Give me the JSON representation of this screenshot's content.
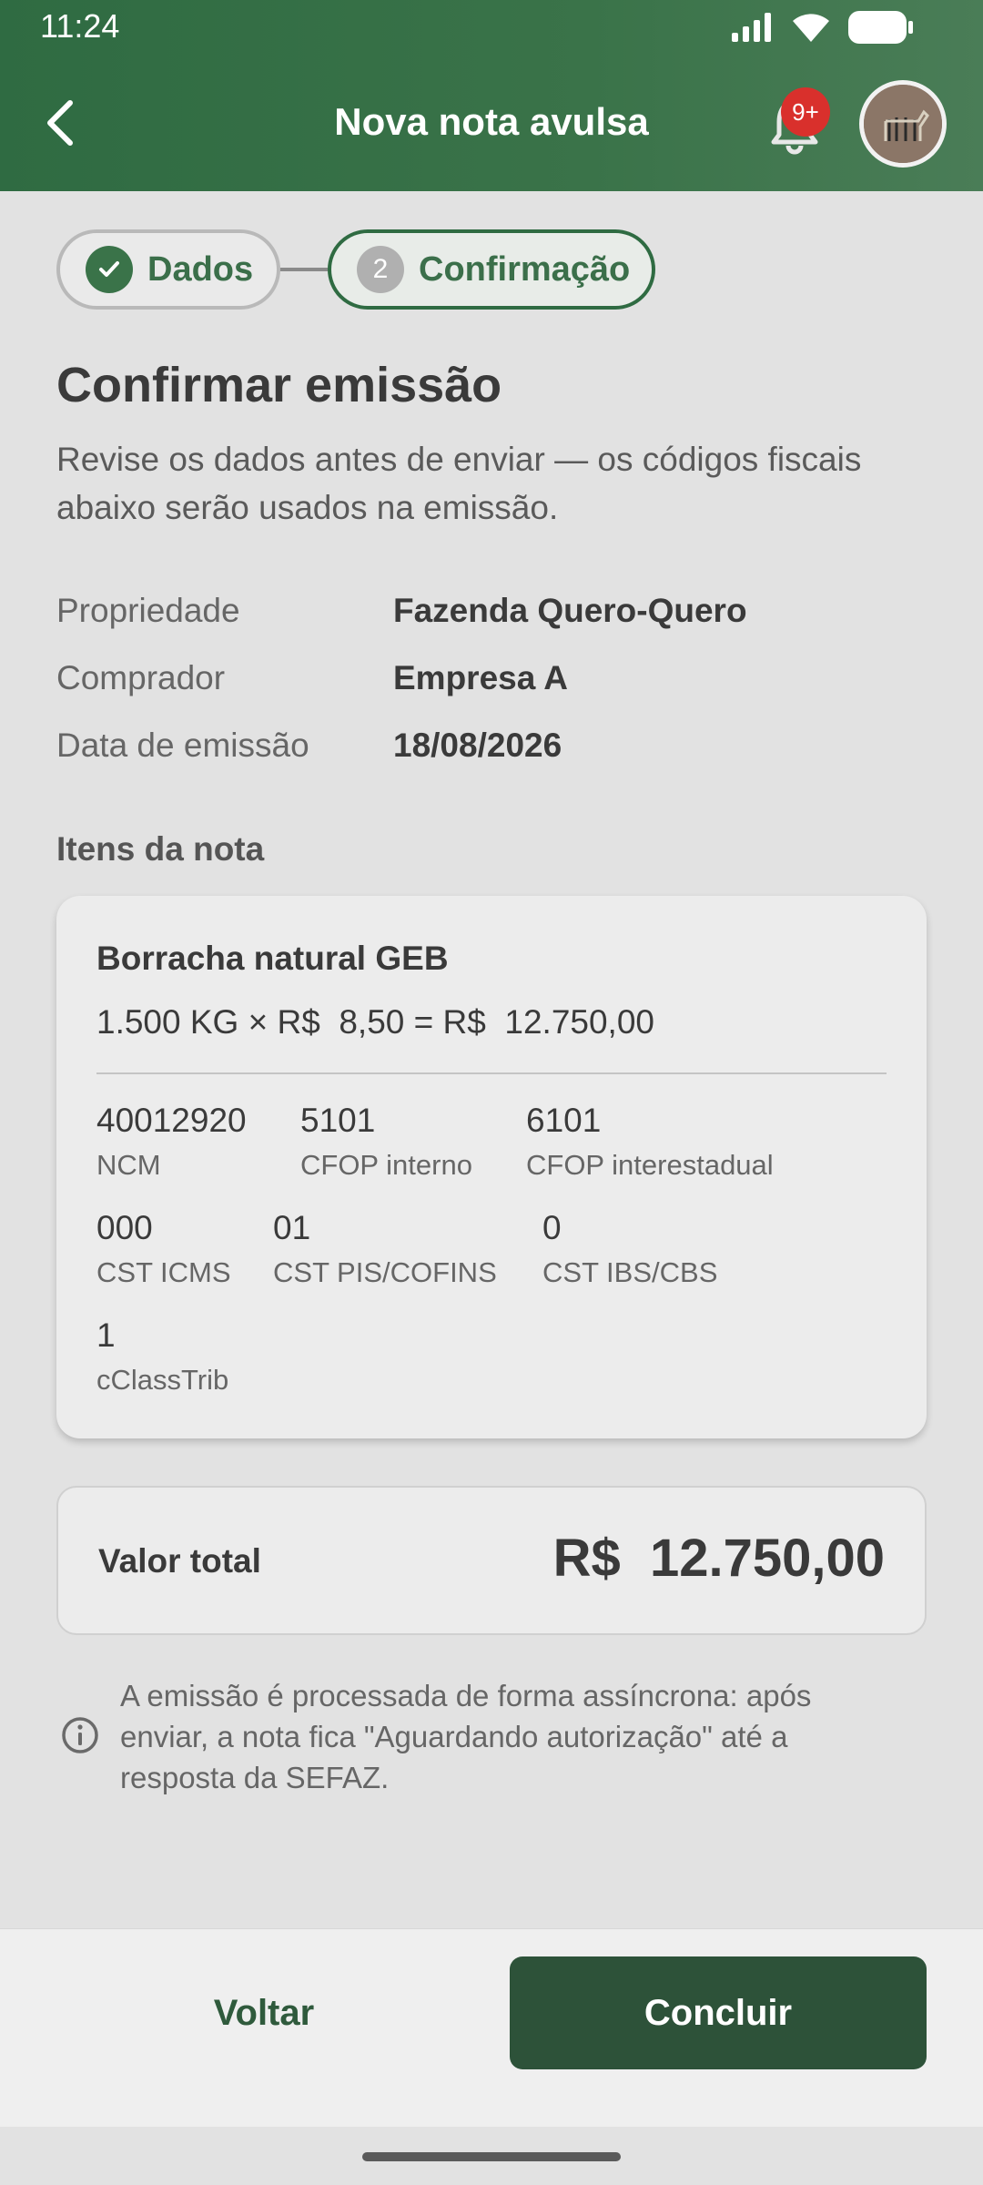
{
  "status_bar": {
    "time": "11:24"
  },
  "header": {
    "title": "Nova nota avulsa",
    "notification_badge": "9+"
  },
  "stepper": {
    "steps": [
      {
        "label": "Dados",
        "state": "done"
      },
      {
        "number": "2",
        "label": "Confirmação",
        "state": "active"
      }
    ]
  },
  "main": {
    "heading": "Confirmar emissão",
    "subtitle": "Revise os dados antes de enviar — os códigos fiscais abaixo serão usados na emissão."
  },
  "info": [
    {
      "label": "Propriedade",
      "value": "Fazenda Quero-Quero"
    },
    {
      "label": "Comprador",
      "value": "Empresa A"
    },
    {
      "label": "Data de emissão",
      "value": "18/08/2026"
    }
  ],
  "items_section": {
    "title": "Itens da nota"
  },
  "item": {
    "name": "Borracha natural GEB",
    "calc": "1.500 KG × R$  8,50 = R$  12.750,00",
    "codes": [
      {
        "value": "40012920",
        "label": "NCM"
      },
      {
        "value": "5101",
        "label": "CFOP interno"
      },
      {
        "value": "6101",
        "label": "CFOP interestadual"
      },
      {
        "value": "000",
        "label": "CST ICMS"
      },
      {
        "value": "01",
        "label": "CST PIS/COFINS"
      },
      {
        "value": "0",
        "label": "CST IBS/CBS"
      },
      {
        "value": "1",
        "label": "cClassTrib"
      }
    ]
  },
  "total": {
    "label": "Valor total",
    "value": "R$  12.750,00"
  },
  "notice": {
    "text": "A emissão é processada de forma assíncrona: após enviar, a nota fica \"Aguardando autorização\" até a resposta da SEFAZ."
  },
  "actions": {
    "back_label": "Voltar",
    "finish_label": "Concluir"
  },
  "colors": {
    "primary": "#2f6b42",
    "button_dark": "#2d5239",
    "badge": "#d9302c"
  }
}
